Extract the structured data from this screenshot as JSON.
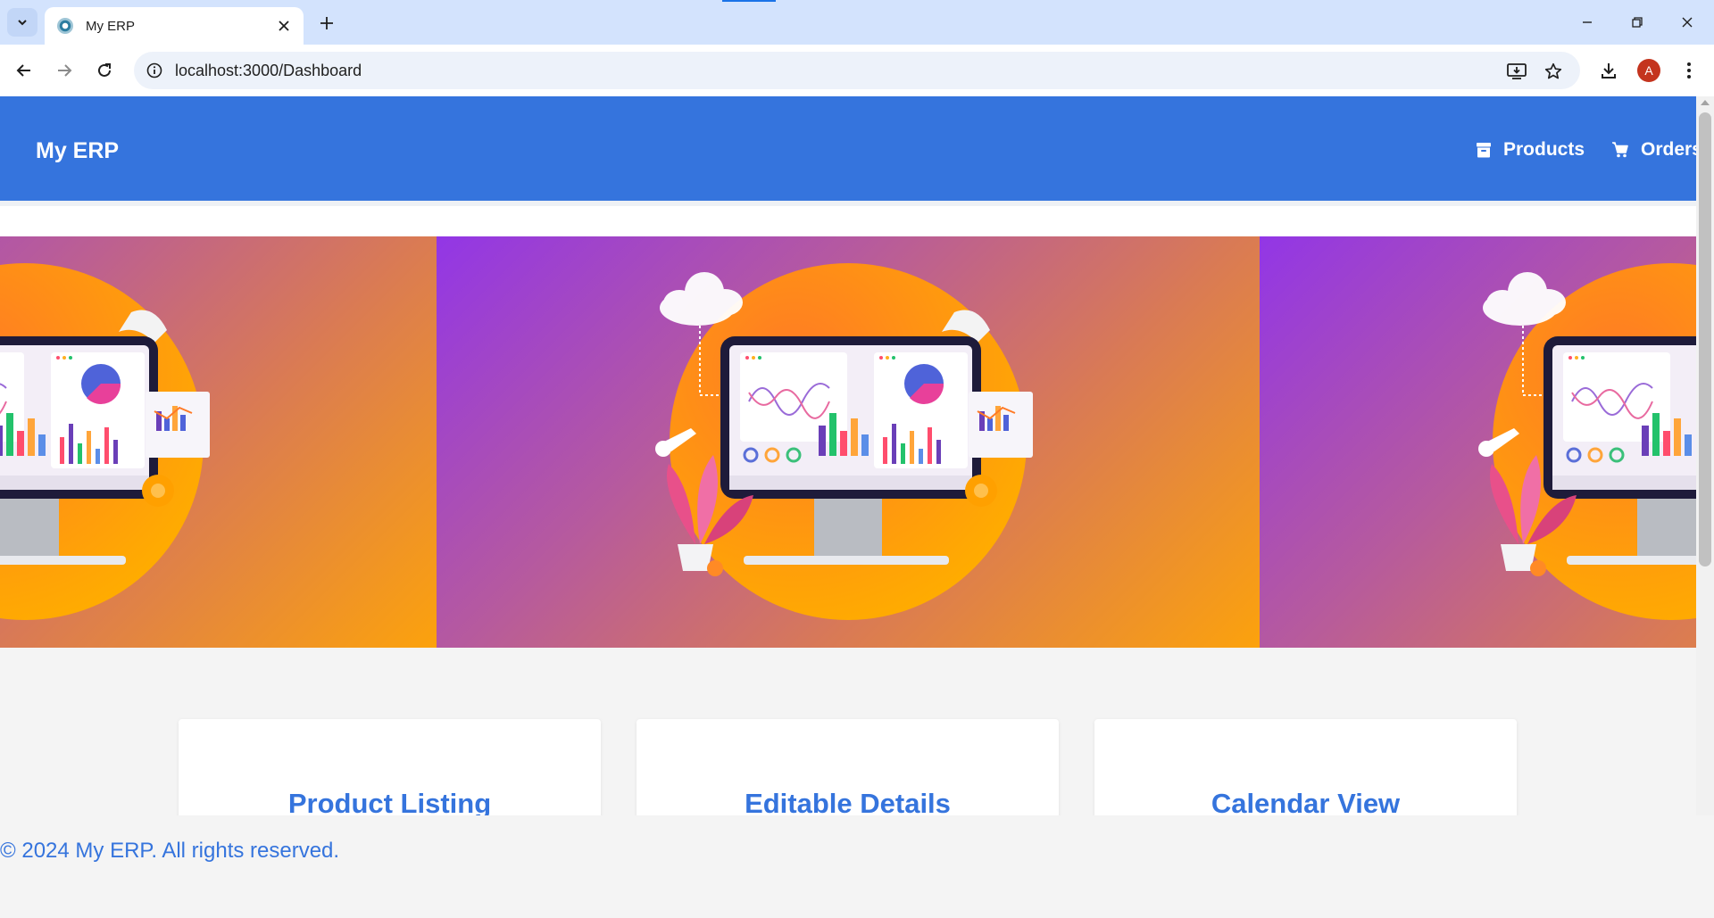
{
  "browser": {
    "tab_title": "My ERP",
    "url": "localhost:3000/Dashboard",
    "profile_initial": "A"
  },
  "header": {
    "brand": "My ERP",
    "nav": [
      {
        "label": "Products",
        "icon": "archive-box-icon"
      },
      {
        "label": "Orders",
        "icon": "shopping-cart-icon"
      }
    ]
  },
  "features": [
    {
      "title": "Product Listing"
    },
    {
      "title": "Editable Details"
    },
    {
      "title": "Calendar View"
    }
  ],
  "footer": {
    "text": "© 2024 My ERP. All rights reserved."
  },
  "colors": {
    "brand_blue": "#3574dd",
    "tab_bar": "#d3e3fd",
    "page_bg": "#f4f4f4"
  }
}
